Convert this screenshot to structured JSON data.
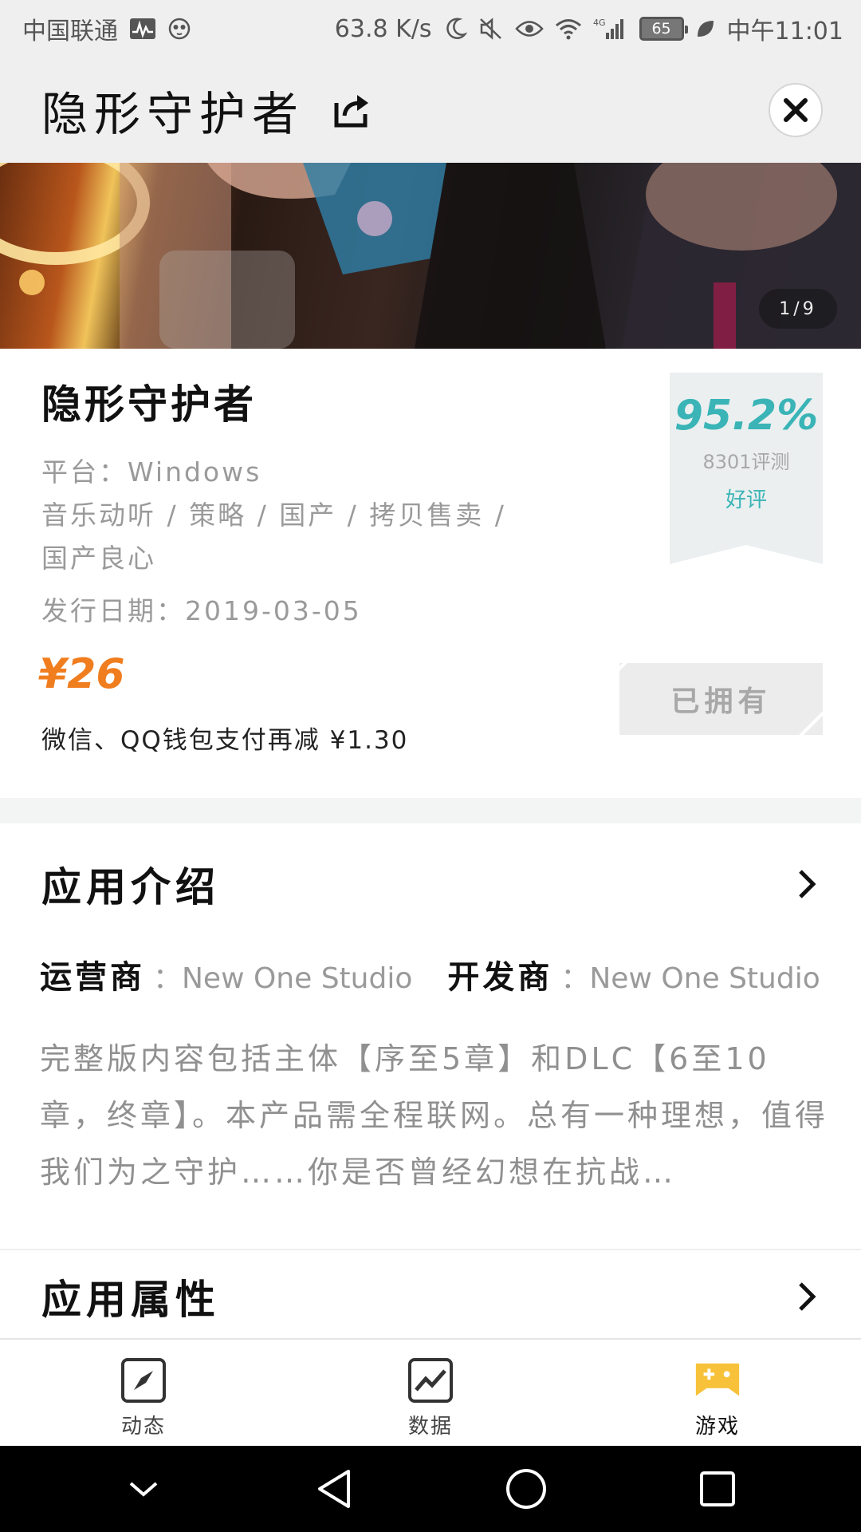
{
  "status_bar": {
    "carrier": "中国联通",
    "net_speed": "63.8 K/s",
    "network_type": "4G",
    "battery": "65",
    "time": "中午11:01"
  },
  "header": {
    "title": "隐形守护者",
    "share_icon": "share-icon",
    "close_icon": "close-icon"
  },
  "hero": {
    "counter": "1/9"
  },
  "game": {
    "name": "隐形守护者",
    "platform_label": "平台：",
    "platform": "Windows",
    "tags_line1": "音乐动听 / 策略 / 国产 / 拷贝售卖 /",
    "tags_line2": "国产良心",
    "release_label": "发行日期：",
    "release_date": "2019-03-05",
    "price": "¥26",
    "discount_text": "微信、QQ钱包支付再减 ¥1.30",
    "owned_label": "已拥有"
  },
  "rating": {
    "score": "95.2%",
    "reviews": "8301评测",
    "label": "好评",
    "accent_color": "#3ab4b6"
  },
  "intro": {
    "title": "应用介绍",
    "operator_label": "运营商",
    "operator": "：New One Studio",
    "developer_label": "开发商",
    "developer": "：New One Studio",
    "description": "完整版内容包括主体【序至5章】和DLC【6至10章，终章】。本产品需全程联网。总有一种理想，值得我们为之守护……你是否曾经幻想在抗战…"
  },
  "attributes": {
    "title": "应用属性"
  },
  "tabs": [
    {
      "label": "动态",
      "icon": "compass-icon",
      "active": false
    },
    {
      "label": "数据",
      "icon": "chart-icon",
      "active": false
    },
    {
      "label": "游戏",
      "icon": "gamepad-icon",
      "active": true
    }
  ],
  "colors": {
    "price": "#f07d1e",
    "rating": "#3ab4b6",
    "active_tab": "#f7c23a"
  }
}
